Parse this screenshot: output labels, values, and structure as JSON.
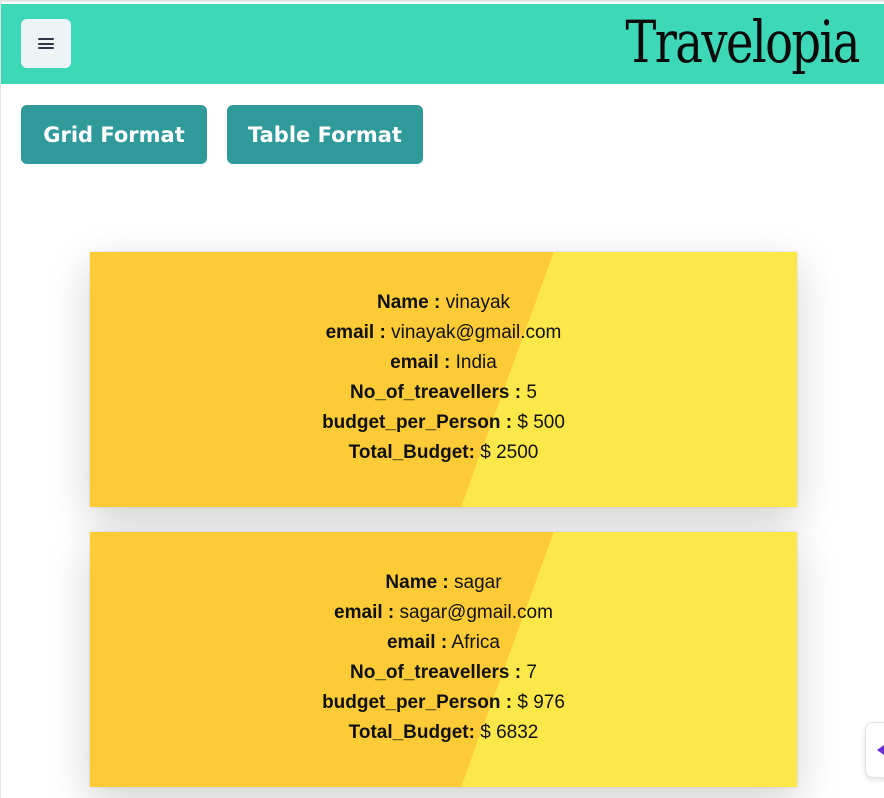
{
  "navbar": {
    "brand": "Travelopia",
    "menu_icon": "hamburger-menu-icon",
    "background": "#3dd8b8"
  },
  "view_toggle": {
    "grid_label": "Grid Format",
    "table_label": "Table Format",
    "button_color": "#30999a"
  },
  "labels": {
    "name": "Name :",
    "email": "email :",
    "destination": "email :",
    "travellers": "No_of_treavellers :",
    "budget_per_person": "budget_per_Person :",
    "total_budget": "Total_Budget:"
  },
  "cards": [
    {
      "name": "vinayak",
      "email": "vinayak@gmail.com",
      "destination": "India",
      "travellers": "5",
      "budget_per_person": "$ 500",
      "total_budget": "$ 2500"
    },
    {
      "name": "sagar",
      "email": "sagar@gmail.com",
      "destination": "Africa",
      "travellers": "7",
      "budget_per_person": "$ 976",
      "total_budget": "$ 6832"
    }
  ],
  "colors": {
    "card_left": "#fdcb36",
    "card_right": "#fde84a",
    "widget_arrow": "#6a2fd6"
  },
  "side_widget": {
    "icon": "chevron-left-icon"
  }
}
